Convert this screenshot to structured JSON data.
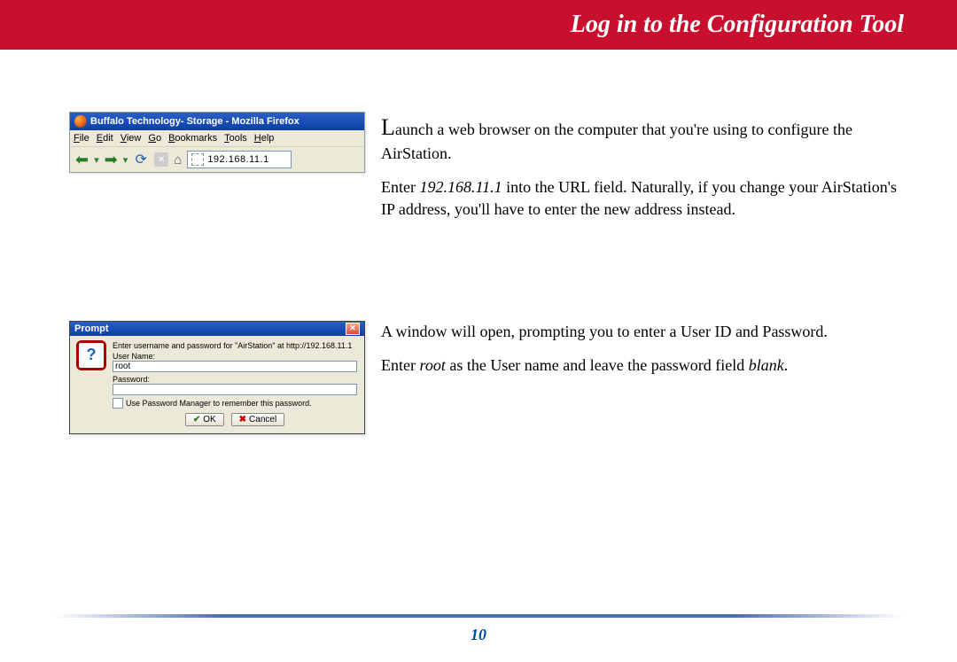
{
  "header": {
    "title": "Log in to the Configuration Tool"
  },
  "browser": {
    "window_title": "Buffalo Technology- Storage - Mozilla Firefox",
    "menu": {
      "file": "File",
      "edit": "Edit",
      "view": "View",
      "go": "Go",
      "bookmarks": "Bookmarks",
      "tools": "Tools",
      "help": "Help"
    },
    "url_value": "192.168.11.1"
  },
  "paras": {
    "p1": "Launch a web browser on the computer that you're using to configure the AirStation.",
    "p2_a": "Enter ",
    "p2_ip": "192.168.11.1",
    "p2_b": " into the URL field.  Naturally, if you change your AirStation's IP address, you'll have to enter the new address instead.",
    "p3": "A window will open, prompting you to enter a User ID and Password.",
    "p4_a": "Enter ",
    "p4_root": "root",
    "p4_b": " as the User name and leave the password field ",
    "p4_blank": "blank",
    "p4_c": "."
  },
  "prompt": {
    "title": "Prompt",
    "instruction": "Enter username and password for \"AirStation\" at http://192.168.11.1",
    "user_label": "User Name:",
    "user_value": "root",
    "pass_label": "Password:",
    "pass_value": "",
    "remember_label": "Use Password Manager to remember this password.",
    "ok": "OK",
    "cancel": "Cancel"
  },
  "page_number": "10"
}
